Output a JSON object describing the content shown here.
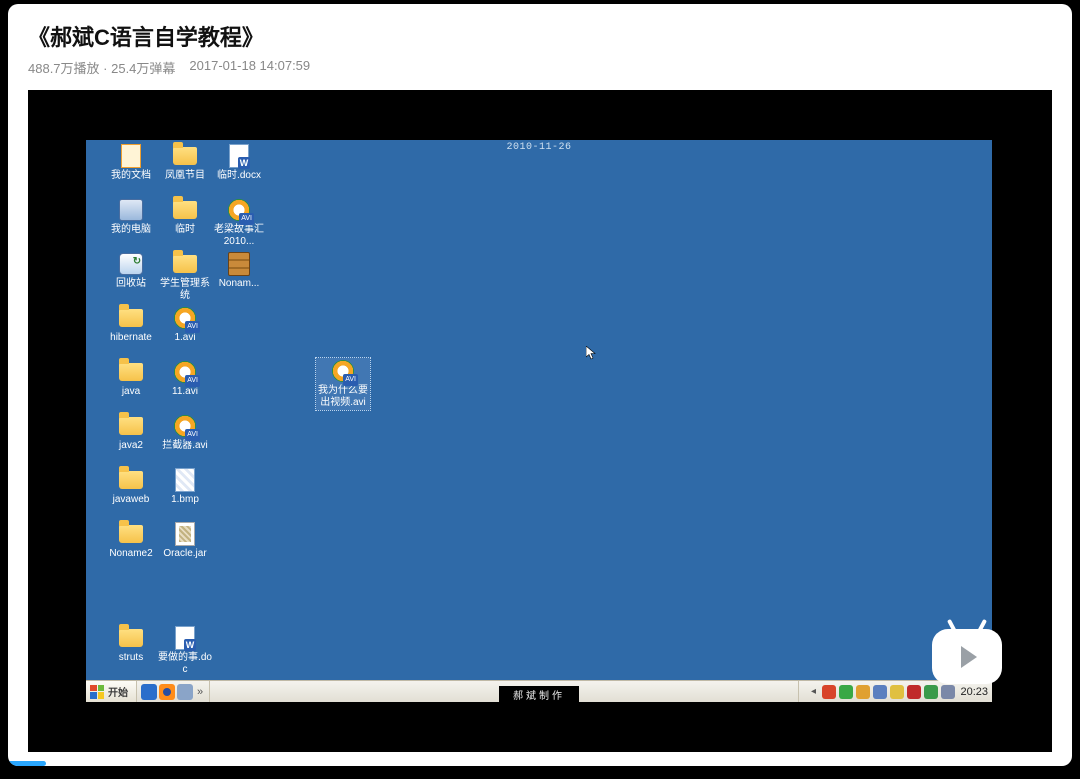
{
  "header": {
    "title": "《郝斌C语言自学教程》",
    "plays": "488.7万播放",
    "danmaku": "25.4万弹幕",
    "timestamp": "2017-01-18 14:07:59"
  },
  "xp": {
    "date_overlay": "2010-11-26",
    "caption": "郝斌制作",
    "taskbar": {
      "start_label": "开始",
      "quicklaunch": [
        "show-desktop",
        "firefox",
        "shell",
        "more"
      ],
      "tray_icons": [
        "expand",
        "red",
        "shield-green",
        "sound",
        "net",
        "warn",
        "x-red",
        "battery",
        "im"
      ],
      "clock": "20:23"
    },
    "icons": {
      "col1": [
        {
          "name": "my-documents",
          "type": "docs",
          "label": "我的文档"
        },
        {
          "name": "my-computer",
          "type": "pc",
          "label": "我的电脑"
        },
        {
          "name": "recycle-bin",
          "type": "bin",
          "label": "回收站"
        },
        {
          "name": "folder-hibernate",
          "type": "folder",
          "label": "hibernate"
        },
        {
          "name": "folder-java",
          "type": "folder",
          "label": "java"
        },
        {
          "name": "folder-java2",
          "type": "folder",
          "label": "java2"
        },
        {
          "name": "folder-javaweb",
          "type": "folder",
          "label": "javaweb"
        },
        {
          "name": "folder-noname2",
          "type": "folder",
          "label": "Noname2"
        },
        {
          "name": "folder-struts",
          "type": "folder",
          "label": "struts"
        }
      ],
      "col2": [
        {
          "name": "folder-fenghuang",
          "type": "folder",
          "label": "凤凰节目"
        },
        {
          "name": "folder-linshi",
          "type": "folder",
          "label": "临时"
        },
        {
          "name": "folder-student-sys",
          "type": "folder",
          "label": "学生管理系统"
        },
        {
          "name": "file-1-avi",
          "type": "avi",
          "label": "1.avi"
        },
        {
          "name": "file-11-avi",
          "type": "avi",
          "label": "11.avi"
        },
        {
          "name": "file-lanjieqi-avi",
          "type": "avi",
          "label": "拦截器.avi"
        },
        {
          "name": "file-1-bmp",
          "type": "bmp",
          "label": "1.bmp"
        },
        {
          "name": "file-oracle-jar",
          "type": "jar",
          "label": "Oracle.jar"
        },
        {
          "name": "file-yaozuo-doc",
          "type": "doc",
          "label": "要做的事.doc"
        }
      ],
      "col3": [
        {
          "name": "file-linshi-docx",
          "type": "docx",
          "label": "临时.docx"
        },
        {
          "name": "file-laoliang-avi",
          "type": "avi",
          "label": "老梁故事汇2010..."
        },
        {
          "name": "file-noname-rar",
          "type": "rar",
          "label": "Nonam..."
        }
      ],
      "floating": {
        "name": "file-why-video-avi",
        "type": "avi",
        "label": "我为什么要出视频.avi",
        "selected": true
      }
    }
  }
}
